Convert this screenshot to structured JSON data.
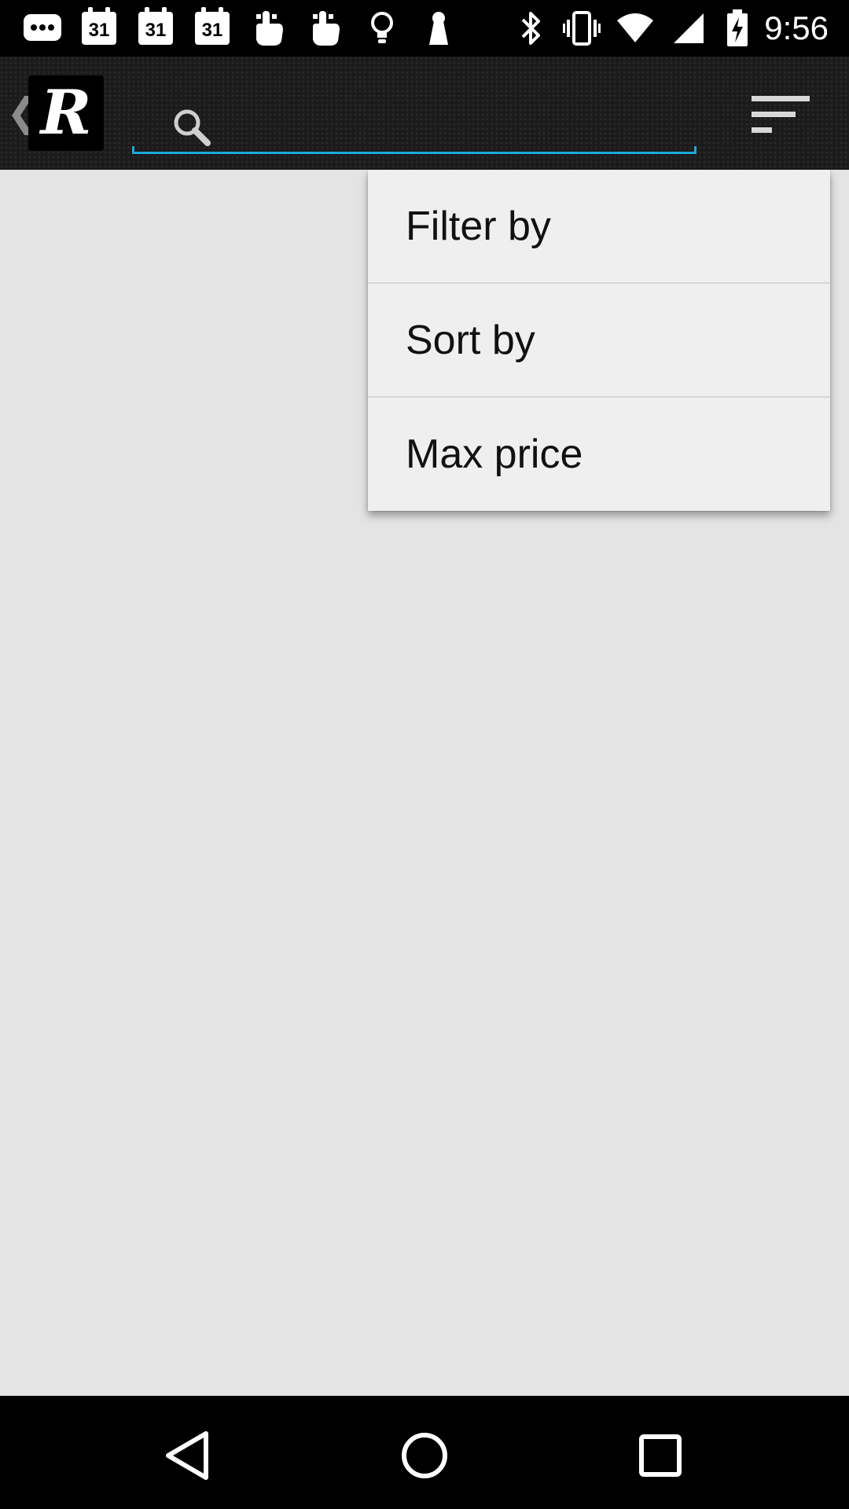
{
  "status_bar": {
    "time": "9:56",
    "calendar_day": "31",
    "icons": [
      "chat-icon",
      "calendar-icon",
      "calendar-icon",
      "calendar-icon",
      "touch-icon",
      "touch-icon",
      "lightbulb-icon",
      "keyhole-icon",
      "bluetooth-icon",
      "vibrate-icon",
      "wifi-icon",
      "signal-icon",
      "battery-icon"
    ]
  },
  "action_bar": {
    "logo_letter": "R",
    "search": {
      "value": "",
      "placeholder": ""
    },
    "accent_color": "#1fa8d8"
  },
  "menu": {
    "items": [
      {
        "label": "Filter by"
      },
      {
        "label": "Sort by"
      },
      {
        "label": "Max price"
      }
    ]
  },
  "nav_bar": {
    "buttons": [
      "back-icon",
      "home-icon",
      "recents-icon"
    ]
  }
}
